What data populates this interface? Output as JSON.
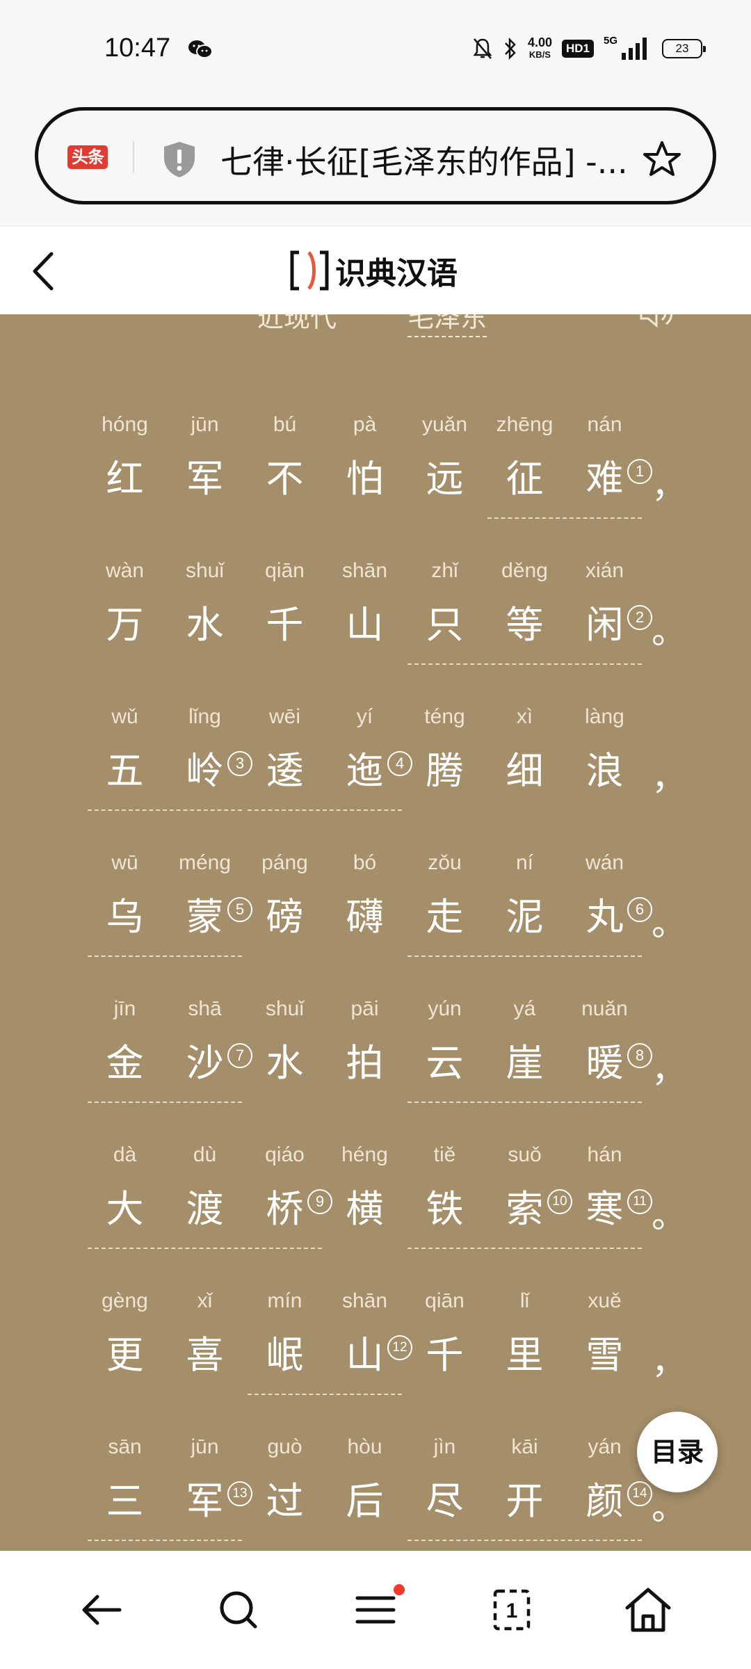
{
  "status_bar": {
    "time": "10:47",
    "network_speed_value": "4.00",
    "network_speed_unit": "KB/S",
    "hd_label": "HD1",
    "signal_label": "5G",
    "battery": "23"
  },
  "url_bar": {
    "brand_label": "头条",
    "page_title": "七律·长征[毛泽东的作品] -..."
  },
  "app_header": {
    "brand_name": "识典汉语"
  },
  "poem": {
    "era": "近现代",
    "separator": "·",
    "author": "毛泽东",
    "lines": [
      {
        "chars": [
          {
            "py": "hóng",
            "hz": "红"
          },
          {
            "py": "jūn",
            "hz": "军"
          },
          {
            "py": "bú",
            "hz": "不"
          },
          {
            "py": "pà",
            "hz": "怕"
          },
          {
            "py": "yuǎn",
            "hz": "远"
          },
          {
            "py": "zhēng",
            "hz": "征"
          },
          {
            "py": "nán",
            "hz": "难"
          }
        ],
        "notes": [
          {
            "after": 6,
            "n": "1"
          }
        ],
        "punct": "，"
      },
      {
        "chars": [
          {
            "py": "wàn",
            "hz": "万"
          },
          {
            "py": "shuǐ",
            "hz": "水"
          },
          {
            "py": "qiān",
            "hz": "千"
          },
          {
            "py": "shān",
            "hz": "山"
          },
          {
            "py": "zhǐ",
            "hz": "只"
          },
          {
            "py": "děng",
            "hz": "等"
          },
          {
            "py": "xián",
            "hz": "闲"
          }
        ],
        "notes": [
          {
            "after": 6,
            "n": "2"
          }
        ],
        "punct": "。"
      },
      {
        "chars": [
          {
            "py": "wǔ",
            "hz": "五"
          },
          {
            "py": "lǐng",
            "hz": "岭"
          },
          {
            "py": "wēi",
            "hz": "逶"
          },
          {
            "py": "yí",
            "hz": "迤"
          },
          {
            "py": "téng",
            "hz": "腾"
          },
          {
            "py": "xì",
            "hz": "细"
          },
          {
            "py": "làng",
            "hz": "浪"
          }
        ],
        "notes": [
          {
            "after": 1,
            "n": "3"
          },
          {
            "after": 3,
            "n": "4"
          }
        ],
        "punct": "，"
      },
      {
        "chars": [
          {
            "py": "wū",
            "hz": "乌"
          },
          {
            "py": "méng",
            "hz": "蒙"
          },
          {
            "py": "páng",
            "hz": "磅"
          },
          {
            "py": "bó",
            "hz": "礴"
          },
          {
            "py": "zǒu",
            "hz": "走"
          },
          {
            "py": "ní",
            "hz": "泥"
          },
          {
            "py": "wán",
            "hz": "丸"
          }
        ],
        "notes": [
          {
            "after": 1,
            "n": "5"
          },
          {
            "after": 6,
            "n": "6"
          }
        ],
        "punct": "。"
      },
      {
        "chars": [
          {
            "py": "jīn",
            "hz": "金"
          },
          {
            "py": "shā",
            "hz": "沙"
          },
          {
            "py": "shuǐ",
            "hz": "水"
          },
          {
            "py": "pāi",
            "hz": "拍"
          },
          {
            "py": "yún",
            "hz": "云"
          },
          {
            "py": "yá",
            "hz": "崖"
          },
          {
            "py": "nuǎn",
            "hz": "暖"
          }
        ],
        "notes": [
          {
            "after": 1,
            "n": "7"
          },
          {
            "after": 6,
            "n": "8"
          }
        ],
        "punct": "，"
      },
      {
        "chars": [
          {
            "py": "dà",
            "hz": "大"
          },
          {
            "py": "dù",
            "hz": "渡"
          },
          {
            "py": "qiáo",
            "hz": "桥"
          },
          {
            "py": "héng",
            "hz": "横"
          },
          {
            "py": "tiě",
            "hz": "铁"
          },
          {
            "py": "suǒ",
            "hz": "索"
          },
          {
            "py": "hán",
            "hz": "寒"
          }
        ],
        "notes": [
          {
            "after": 2,
            "n": "9"
          },
          {
            "after": 5,
            "n": "10"
          },
          {
            "after": 6,
            "n": "11"
          }
        ],
        "punct": "。"
      },
      {
        "chars": [
          {
            "py": "gèng",
            "hz": "更"
          },
          {
            "py": "xǐ",
            "hz": "喜"
          },
          {
            "py": "mín",
            "hz": "岷"
          },
          {
            "py": "shān",
            "hz": "山"
          },
          {
            "py": "qiān",
            "hz": "千"
          },
          {
            "py": "lǐ",
            "hz": "里"
          },
          {
            "py": "xuě",
            "hz": "雪"
          }
        ],
        "notes": [
          {
            "after": 3,
            "n": "12"
          }
        ],
        "punct": "，"
      },
      {
        "chars": [
          {
            "py": "sān",
            "hz": "三"
          },
          {
            "py": "jūn",
            "hz": "军"
          },
          {
            "py": "guò",
            "hz": "过"
          },
          {
            "py": "hòu",
            "hz": "后"
          },
          {
            "py": "jìn",
            "hz": "尽"
          },
          {
            "py": "kāi",
            "hz": "开"
          },
          {
            "py": "yán",
            "hz": "颜"
          }
        ],
        "notes": [
          {
            "after": 1,
            "n": "13"
          },
          {
            "after": 6,
            "n": "14"
          }
        ],
        "punct": "。"
      }
    ]
  },
  "toc_button": {
    "label": "目录"
  },
  "bottom_nav": {
    "tab_count": "1"
  },
  "colors": {
    "content_background": "#a58f6a",
    "text": "#ffffff",
    "brand_red": "#e23b32"
  }
}
